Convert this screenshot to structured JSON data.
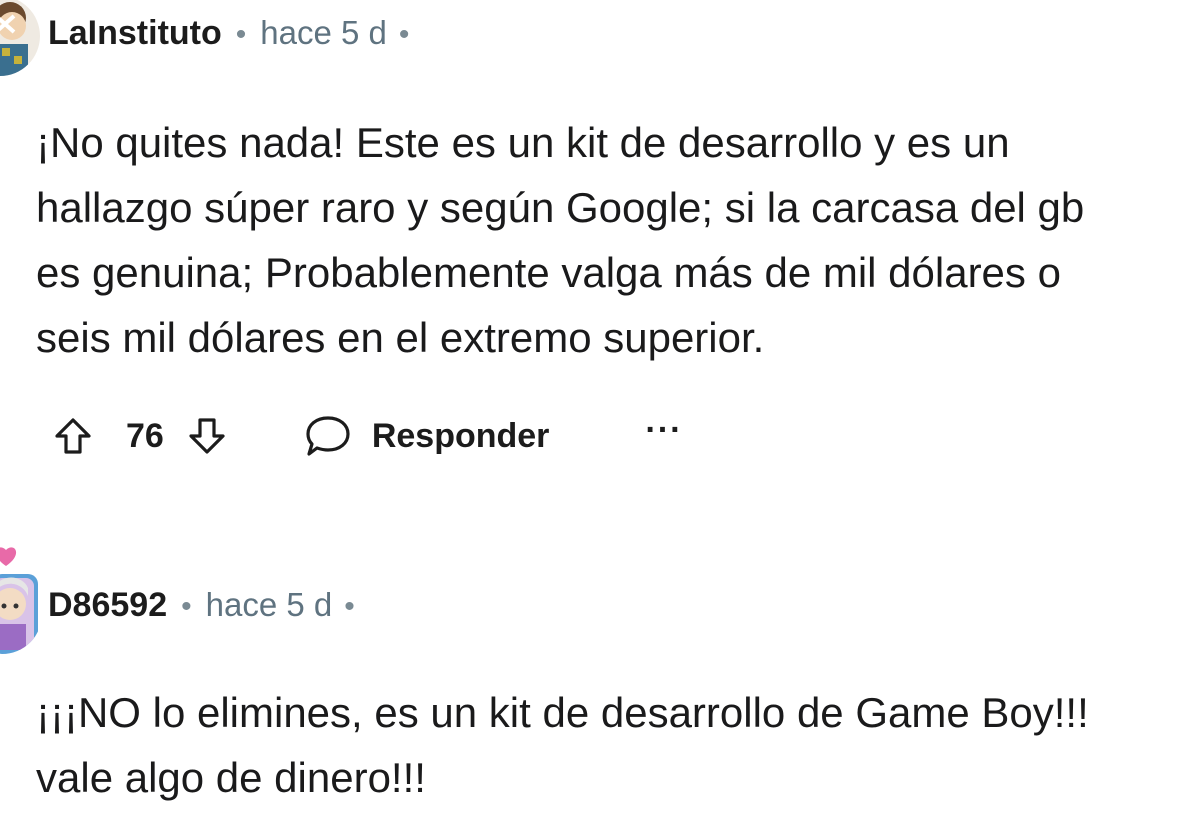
{
  "comments": [
    {
      "username": "LaInstituto",
      "time": "hace 5 d",
      "separator": "•",
      "body": "¡No quites nada! Este es un kit de desarrollo y es un\nhallazgo súper raro y según Google; si la carcasa del gb\nes genuina; Probablemente valga más de mil dólares o\nseis mil dólares en el extremo superior.",
      "score": "76",
      "reply_label": "Responder",
      "more_label": "···",
      "avatar_icon": "snoo-avatar-icon"
    },
    {
      "username": "D86592",
      "time": "hace 5 d",
      "separator": "•",
      "body": "¡¡¡NO lo elimines, es un kit de desarrollo de Game Boy!!!\nvale algo de dinero!!!",
      "avatar_icon": "snoo-avatar-icon"
    }
  ],
  "colors": {
    "text": "#1c1c1c",
    "meta": "#5f7380",
    "background": "#ffffff"
  }
}
